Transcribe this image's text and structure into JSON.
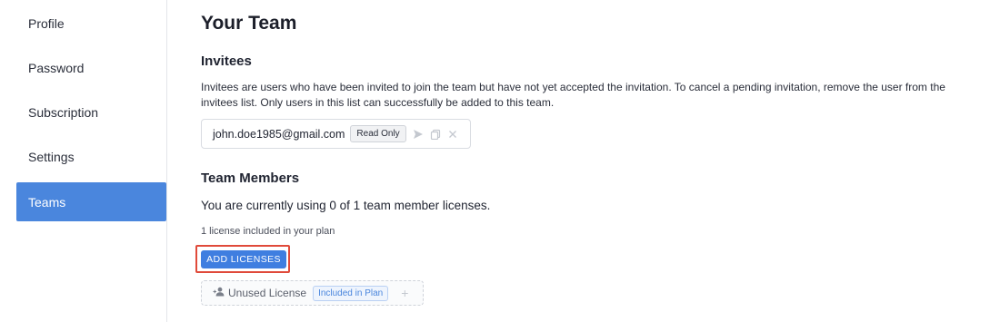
{
  "sidebar": {
    "items": [
      {
        "label": "Profile"
      },
      {
        "label": "Password"
      },
      {
        "label": "Subscription"
      },
      {
        "label": "Settings"
      },
      {
        "label": "Teams",
        "active": true
      }
    ]
  },
  "main": {
    "title": "Your Team",
    "invitees": {
      "title": "Invitees",
      "description": "Invitees are users who have been invited to join the team but have not yet accepted the invitation. To cancel a pending invitation, remove the user from the invitees list. Only users in this list can successfully be added to this team.",
      "items": [
        {
          "email": "john.doe1985@gmail.com",
          "role": "Read Only",
          "icons": [
            "send-icon",
            "copy-icon",
            "close-icon"
          ]
        }
      ]
    },
    "team_members": {
      "title": "Team Members",
      "usage_text": "You are currently using 0 of 1 team member licenses.",
      "plan_note": "1 license included in your plan",
      "add_button": "ADD LICENSES",
      "license_slot": {
        "label": "Unused License",
        "badge": "Included in Plan",
        "icon": "add-user-icon"
      }
    }
  },
  "colors": {
    "accent": "#4a86dd",
    "button": "#3f7ee0",
    "highlight": "#e04a3a"
  }
}
